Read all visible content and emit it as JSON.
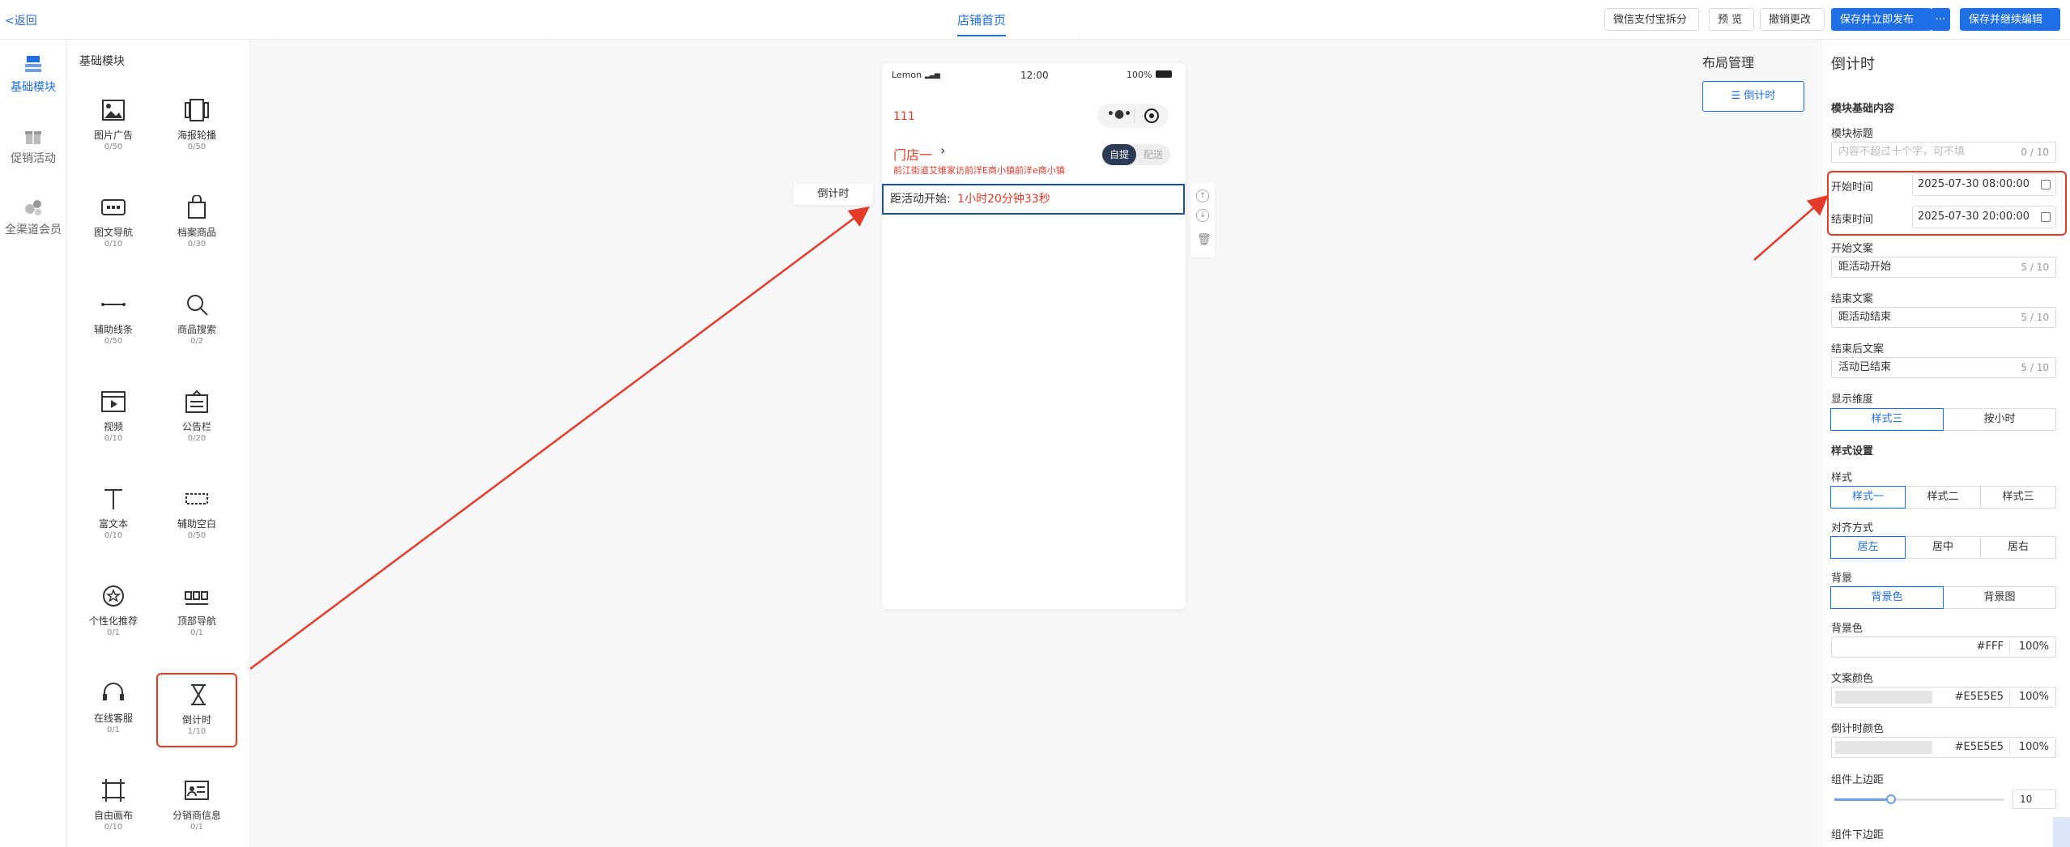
{
  "topbar": {
    "back_label": "<返回",
    "center_tab": "店铺首页",
    "buttons": [
      "微信支付宝拆分",
      "预 览",
      "撤销更改",
      "保存并立即发布",
      "···",
      "保存并继续编辑"
    ]
  },
  "leftnav": {
    "items": [
      {
        "label": "基础模块",
        "icon": "grid-blocks-icon",
        "active": true
      },
      {
        "label": "促销活动",
        "icon": "gift-icon",
        "active": false
      },
      {
        "label": "全渠道会员",
        "icon": "members-icon",
        "active": false
      }
    ]
  },
  "modules": {
    "title": "基础模块",
    "items": [
      {
        "label": "图片广告",
        "count": "0/50",
        "icon": "image-icon"
      },
      {
        "label": "海报轮播",
        "count": "0/50",
        "icon": "carousel-icon"
      },
      {
        "label": "图文导航",
        "count": "0/10",
        "icon": "nav-dots-icon"
      },
      {
        "label": "档案商品",
        "count": "0/30",
        "icon": "bag-icon"
      },
      {
        "label": "辅助线条",
        "count": "0/50",
        "icon": "line-icon"
      },
      {
        "label": "商品搜索",
        "count": "0/2",
        "icon": "search-icon"
      },
      {
        "label": "视频",
        "count": "0/10",
        "icon": "video-icon"
      },
      {
        "label": "公告栏",
        "count": "0/20",
        "icon": "notice-icon"
      },
      {
        "label": "富文本",
        "count": "0/10",
        "icon": "text-icon"
      },
      {
        "label": "辅助空白",
        "count": "0/50",
        "icon": "blank-icon"
      },
      {
        "label": "个性化推荐",
        "count": "0/1",
        "icon": "star-icon"
      },
      {
        "label": "顶部导航",
        "count": "0/1",
        "icon": "topnav-icon"
      },
      {
        "label": "在线客服",
        "count": "0/1",
        "icon": "headset-icon"
      },
      {
        "label": "倒计时",
        "count": "1/10",
        "icon": "hourglass-icon",
        "selected": true
      },
      {
        "label": "自由画布",
        "count": "0/10",
        "icon": "canvas-icon"
      },
      {
        "label": "分销商信息",
        "count": "0/1",
        "icon": "card-icon"
      }
    ]
  },
  "phone": {
    "carrier": "Lemon",
    "time": "12:00",
    "battery": "100%",
    "store_code": "111",
    "store_name": "门店一",
    "address": "前江街道艾维家访前洋E商小镇前洋e商小镇",
    "pickup_label": "自提",
    "delivery_label": "配送",
    "float_label": "倒计时",
    "countdown_prefix": "距活动开始:",
    "countdown_value": "1小时20分钟33秒"
  },
  "layout": {
    "title": "布局管理",
    "item": "倒计时"
  },
  "settings": {
    "panel_title": "倒计时",
    "section_basic": "模块基础内容",
    "module_title_label": "模块标题",
    "module_title_placeholder": "内容不超过十个字，可不填",
    "module_title_count": "0 / 10",
    "start_time_label": "开始时间",
    "start_time_value": "2025-07-30 08:00:00",
    "end_time_label": "结束时间",
    "end_time_value": "2025-07-30 20:00:00",
    "start_text_label": "开始文案",
    "start_text_value": "距活动开始",
    "start_text_count": "5 / 10",
    "end_text_label": "结束文案",
    "end_text_value": "距活动结束",
    "end_text_count": "5 / 10",
    "after_text_label": "结束后文案",
    "after_text_value": "活动已结束",
    "after_text_count": "5 / 10",
    "dimension_label": "显示维度",
    "dimension_options": [
      "样式三",
      "按小时"
    ],
    "style_section": "样式设置",
    "style_label": "样式",
    "style_options": [
      "样式一",
      "样式二",
      "样式三"
    ],
    "align_label": "对齐方式",
    "align_options": [
      "居左",
      "居中",
      "居右"
    ],
    "bg_label": "背景",
    "bg_options": [
      "背景色",
      "背景图"
    ],
    "bg_color_label": "背景色",
    "bg_color_hex": "#FFF",
    "bg_color_pct": "100%",
    "text_color_label": "文案颜色",
    "text_color_hex": "#E5E5E5",
    "text_color_pct": "100%",
    "cd_color_label": "倒计时颜色",
    "cd_color_hex": "#E5E5E5",
    "cd_color_pct": "100%",
    "top_margin_label": "组件上边距",
    "top_margin_value": "10",
    "bottom_margin_label": "组件下边距"
  },
  "colors": {
    "accent": "#1f6fe6",
    "highlight": "#e23b2a",
    "dark_pill": "#2b3a55"
  }
}
